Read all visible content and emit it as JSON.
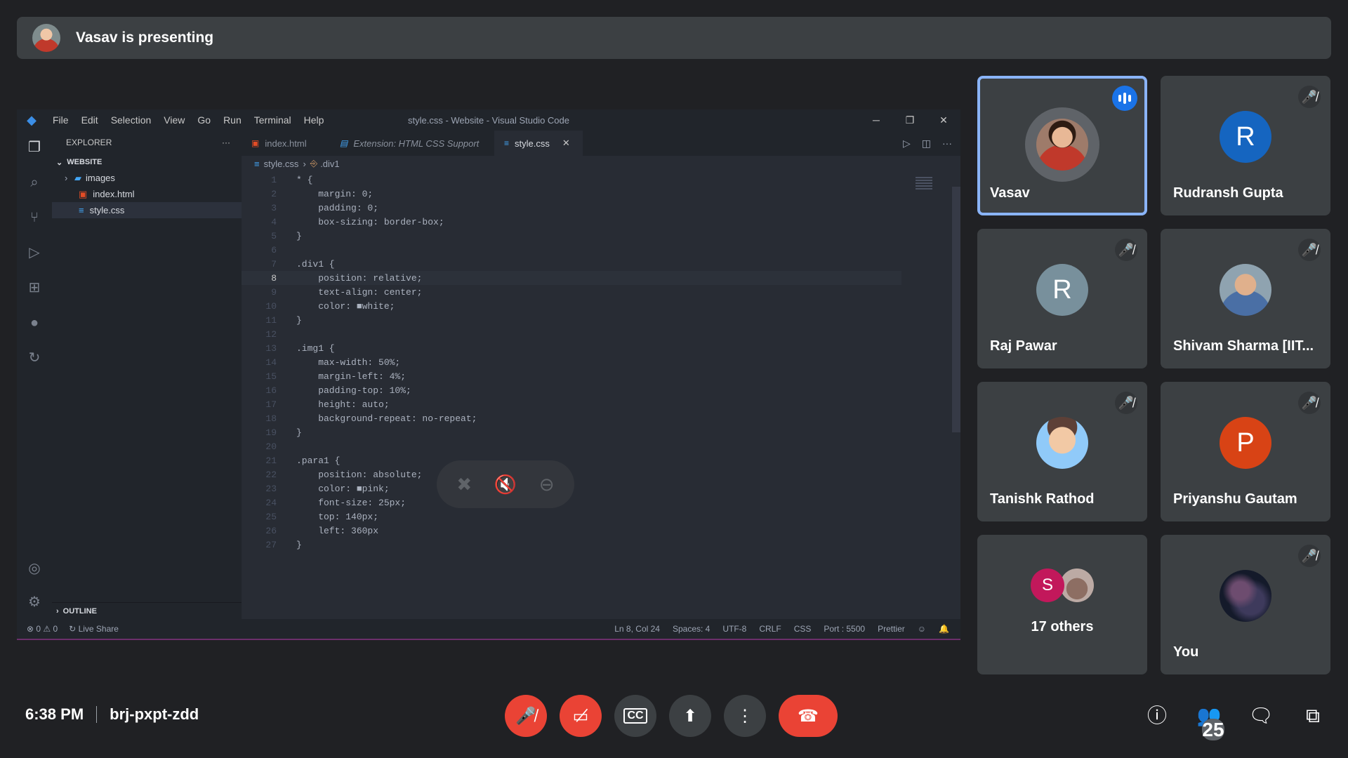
{
  "banner": {
    "text": "Vasav is presenting"
  },
  "vscode": {
    "menu": [
      "File",
      "Edit",
      "Selection",
      "View",
      "Go",
      "Run",
      "Terminal",
      "Help"
    ],
    "window_title": "style.css - Website - Visual Studio Code",
    "explorer_label": "EXPLORER",
    "workspace": "WEBSITE",
    "files": [
      "images",
      "index.html",
      "style.css"
    ],
    "outline_label": "OUTLINE",
    "tabs": [
      "index.html",
      "Extension: HTML CSS Support",
      "style.css"
    ],
    "breadcrumb": [
      "style.css",
      ".div1"
    ],
    "code_lines": [
      "* {",
      "    margin: 0;",
      "    padding: 0;",
      "    box-sizing: border-box;",
      "}",
      "",
      ".div1 {",
      "    position: relative;",
      "    text-align: center;",
      "    color: ■white;",
      "}",
      "",
      ".img1 {",
      "    max-width: 50%;",
      "    margin-left: 4%;",
      "    padding-top: 10%;",
      "    height: auto;",
      "    background-repeat: no-repeat;",
      "}",
      "",
      ".para1 {",
      "    position: absolute;",
      "    color: ■pink;",
      "    font-size: 25px;",
      "    top: 140px;",
      "    left: 360px",
      "}"
    ],
    "line_numbers": [
      "1",
      "2",
      "3",
      "4",
      "5",
      "6",
      "7",
      "8",
      "9",
      "10",
      "11",
      "12",
      "13",
      "14",
      "15",
      "16",
      "17",
      "18",
      "19",
      "20",
      "21",
      "22",
      "23",
      "24",
      "25",
      "26",
      "27"
    ],
    "status_left": [
      "⊗ 0 ⚠ 0",
      "Live Share"
    ],
    "status_right": [
      "Ln 8, Col 24",
      "Spaces: 4",
      "UTF-8",
      "CRLF",
      "CSS",
      "Port : 5500",
      "Prettier"
    ]
  },
  "participants": [
    {
      "name": "Vasav",
      "speaking": true
    },
    {
      "name": "Rudransh Gupta",
      "initial": "R",
      "color": "#1565c0"
    },
    {
      "name": "Raj Pawar",
      "initial": "R",
      "color": "#78909c"
    },
    {
      "name": "Shivam Sharma [IIT..."
    },
    {
      "name": "Tanishk Rathod"
    },
    {
      "name": "Priyanshu Gautam",
      "initial": "P",
      "color": "#d84315"
    },
    {
      "others_label": "17 others",
      "initial": "S"
    },
    {
      "name": "You"
    }
  ],
  "meeting": {
    "time": "6:38 PM",
    "code": "brj-pxpt-zdd",
    "people_count": "25"
  },
  "colors": {
    "accent": "#8ab4f8",
    "danger": "#ea4335",
    "tile": "#3c4043",
    "background": "#202124"
  }
}
